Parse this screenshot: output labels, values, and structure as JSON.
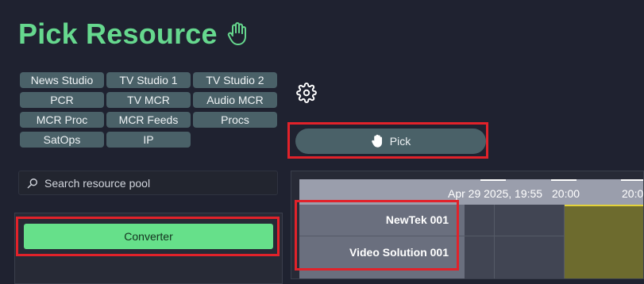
{
  "header": {
    "title": "Pick Resource"
  },
  "groups": [
    [
      "News Studio",
      "TV Studio 1",
      "TV Studio 2"
    ],
    [
      "PCR",
      "TV MCR",
      "Audio MCR"
    ],
    [
      "MCR Proc",
      "MCR Feeds",
      "Procs"
    ],
    [
      "SatOps",
      "IP"
    ]
  ],
  "actions": {
    "pick_label": "Pick"
  },
  "search": {
    "placeholder": "Search resource pool"
  },
  "selected_resource": {
    "label": "Converter"
  },
  "timeline": {
    "labels": [
      "Apr 29 2025, 19:55",
      "20:00",
      "20:0"
    ],
    "resources": [
      "NewTek 001",
      "Video Solution 001"
    ]
  },
  "colors": {
    "accent_green": "#66d88e",
    "button_bg": "#4a6168",
    "highlight_red": "#e1222a",
    "future_window": "#6d6b2e"
  }
}
